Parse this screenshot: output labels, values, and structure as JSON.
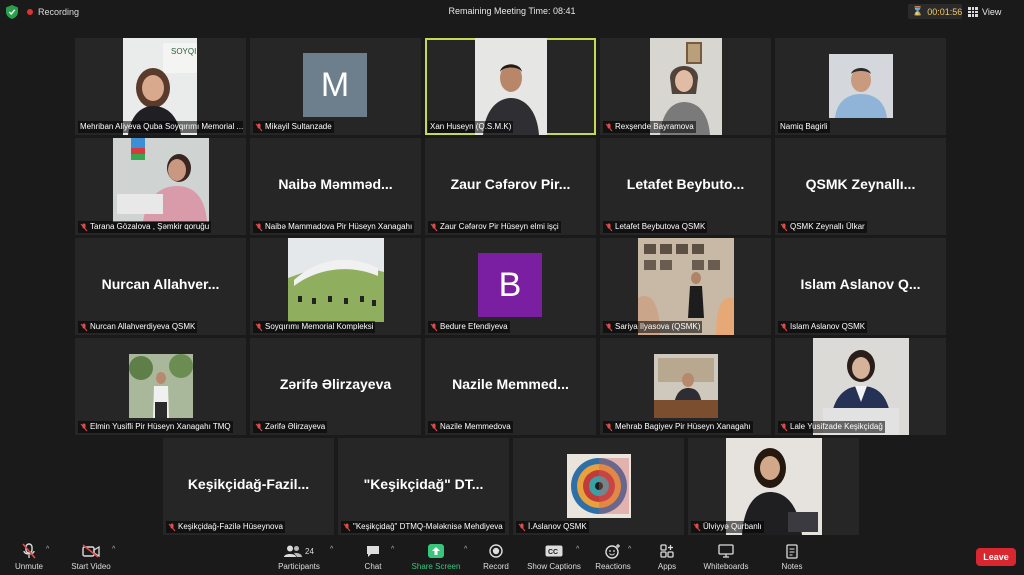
{
  "topbar": {
    "recording": "Recording",
    "remaining": "Remaining Meeting Time: 08:41",
    "timer": "00:01:56",
    "view": "View"
  },
  "tiles": [
    {
      "label": "Mehriban Aliyeva Quba Soyqırımı  Memorial ...",
      "muted": false,
      "type": "photo"
    },
    {
      "label": "Mikayil Sultanzade",
      "muted": true,
      "type": "initial",
      "initial": "M"
    },
    {
      "label": "Xan Huseyn (Q.S.M.K)",
      "muted": false,
      "type": "photo",
      "active": true
    },
    {
      "label": "Rexşende Bayramova",
      "muted": true,
      "type": "photo"
    },
    {
      "label": "Namiq Bagirli",
      "muted": false,
      "type": "photo"
    },
    {
      "label": "Tarana Gözalova , Şəmkir qoruğu",
      "muted": true,
      "type": "photo"
    },
    {
      "label": "Naibə Mammadova Pir Hüseyn Xanagahı",
      "muted": true,
      "type": "name",
      "display": "Naibə  Məmməd..."
    },
    {
      "label": "Zaur Cəfərov Pir Hüseyn elmi işçi",
      "muted": true,
      "type": "name",
      "display": "Zaur  Cəfərov  Pir..."
    },
    {
      "label": "Letafet Beybutova QSMK",
      "muted": true,
      "type": "name",
      "display": "Letafet  Beybuto..."
    },
    {
      "label": "QSMK Zeynallı Ülkar",
      "muted": true,
      "type": "name",
      "display": "QSMK  Zeynallı..."
    },
    {
      "label": "Nurcan Allahverdiyeva QSMK",
      "muted": true,
      "type": "name",
      "display": "Nurcan  Allahver..."
    },
    {
      "label": "Soyqırımı Memorial Kompleksi",
      "muted": true,
      "type": "photo"
    },
    {
      "label": "Bedure Efendiyeva",
      "muted": true,
      "type": "initial",
      "initial": "B"
    },
    {
      "label": "Sariya Ilyasova (QSMK)",
      "muted": true,
      "type": "photo"
    },
    {
      "label": "Islam Aslanov QSMK",
      "muted": true,
      "type": "name",
      "display": "Islam  Aslanov  Q..."
    },
    {
      "label": "Elmin Yusifli Pir Hüseyn Xanagahı TMQ",
      "muted": true,
      "type": "photo"
    },
    {
      "label": "Zərifə Əlirzayeva",
      "muted": true,
      "type": "name",
      "display": "Zərifə  Əlirzayeva"
    },
    {
      "label": "Nazile Memmedova",
      "muted": true,
      "type": "name",
      "display": "Nazile  Memmed..."
    },
    {
      "label": "Mehrab Bagiyev Pir Hüseyn Xanagahı",
      "muted": true,
      "type": "photo"
    },
    {
      "label": "Lale Yusifzade Keşikçidağ",
      "muted": true,
      "type": "photo"
    },
    {
      "label": "Keşikçidağ-Fazilə Hüseynova",
      "muted": true,
      "type": "name",
      "display": "Keşikçidağ-Fazil..."
    },
    {
      "label": "\"Keşikçidağ\" DTMQ-Mələknisə Mehdiyeva",
      "muted": true,
      "type": "name",
      "display": "\"Keşikçidağ\"  DT..."
    },
    {
      "label": "İ.Aslanov QSMK",
      "muted": true,
      "type": "photo"
    },
    {
      "label": "Ülviyyə Qurbanlı",
      "muted": true,
      "type": "photo"
    }
  ],
  "toolbar": {
    "unmute": "Unmute",
    "start_video": "Start Video",
    "participants": "Participants",
    "participant_count": "24",
    "chat": "Chat",
    "share_screen": "Share Screen",
    "record": "Record",
    "show_captions": "Show Captions",
    "reactions": "Reactions",
    "apps": "Apps",
    "whiteboards": "Whiteboards",
    "notes": "Notes",
    "leave": "Leave"
  },
  "colors": {
    "accent_active": "#c6d954",
    "leave": "#d9272f",
    "share": "#38c77a",
    "initial_m": "#6d7f8c",
    "initial_b": "#7b1fa2"
  }
}
